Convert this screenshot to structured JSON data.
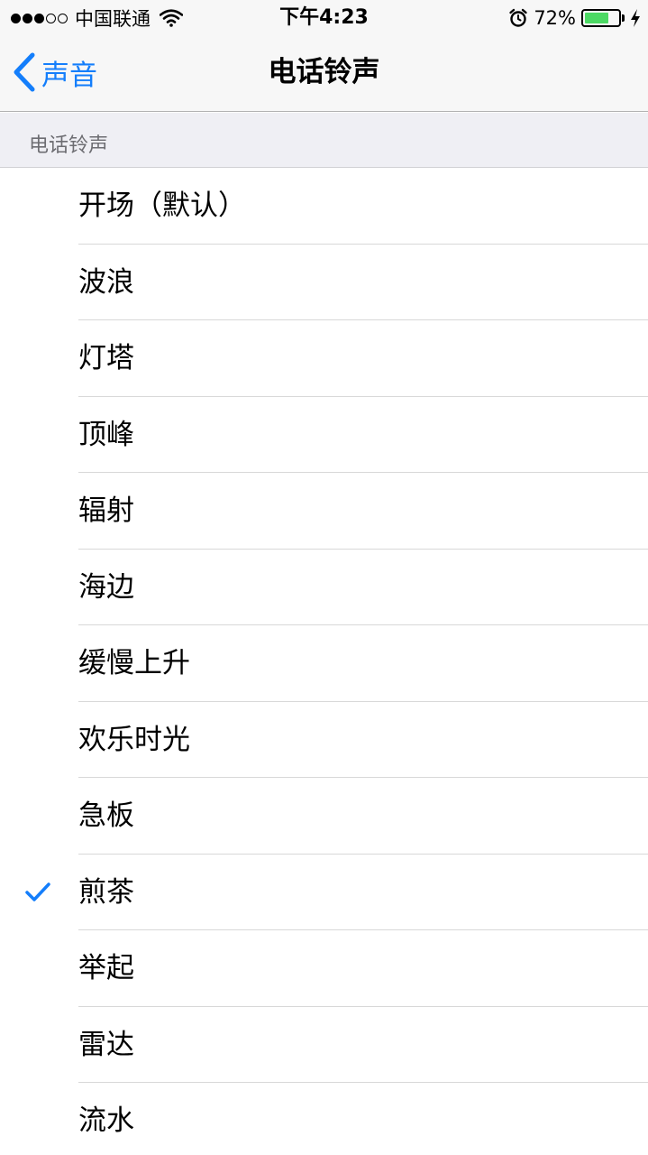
{
  "status_bar": {
    "carrier": "中国联通",
    "time": "下午4:23",
    "battery_percent": "72%",
    "battery_level": 0.72,
    "signal_bars": 3,
    "signal_total": 5,
    "icons": [
      "wifi-icon",
      "alarm-icon",
      "charging-bolt-icon"
    ]
  },
  "nav": {
    "back_label": "声音",
    "title": "电话铃声"
  },
  "section": {
    "header": "电话铃声"
  },
  "ringtones": [
    {
      "label": "开场（默认）",
      "selected": false
    },
    {
      "label": "波浪",
      "selected": false
    },
    {
      "label": "灯塔",
      "selected": false
    },
    {
      "label": "顶峰",
      "selected": false
    },
    {
      "label": "辐射",
      "selected": false
    },
    {
      "label": "海边",
      "selected": false
    },
    {
      "label": "缓慢上升",
      "selected": false
    },
    {
      "label": "欢乐时光",
      "selected": false
    },
    {
      "label": "急板",
      "selected": false
    },
    {
      "label": "煎茶",
      "selected": true
    },
    {
      "label": "举起",
      "selected": false
    },
    {
      "label": "雷达",
      "selected": false
    },
    {
      "label": "流水",
      "selected": false
    }
  ],
  "colors": {
    "accent": "#147efb",
    "battery": "#4cd964",
    "bar_background": "#f7f7f7",
    "section_background": "#efeff4"
  }
}
